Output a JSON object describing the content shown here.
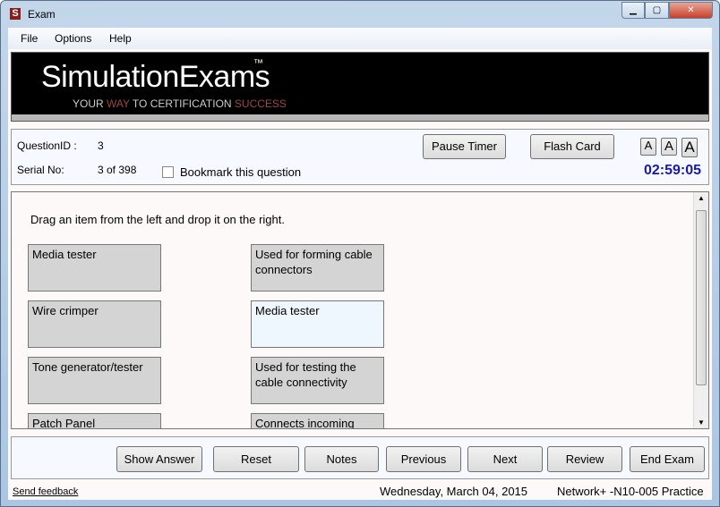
{
  "window": {
    "title": "Exam",
    "app_icon": "S",
    "controls": [
      "minimize",
      "maximize",
      "close"
    ]
  },
  "menu": [
    "File",
    "Options",
    "Help"
  ],
  "banner": {
    "logo": "SimulationExams",
    "tm": "™",
    "tagline": [
      "YOUR ",
      "WAY",
      " TO CERTIFICATION ",
      "SUCCESS"
    ]
  },
  "info": {
    "question_id_label": "QuestionID :",
    "question_id": "3",
    "serial_label": "Serial No:",
    "serial": "3 of 398",
    "bookmark_label": "Bookmark this question",
    "bookmark_checked": false,
    "pause_timer": "Pause Timer",
    "flash_card": "Flash Card",
    "font_sizes": [
      "A",
      "A",
      "A"
    ],
    "timer": "02:59:05"
  },
  "question": {
    "instruction": "Drag an item from the left and drop it on the right.",
    "left_items": [
      "Media tester",
      "Wire crimper",
      "Tone generator/tester",
      "Patch Panel"
    ],
    "right_items": [
      "Used for forming cable connectors",
      "Media tester",
      "Used for testing the cable connectivity",
      "Connects incoming"
    ]
  },
  "buttons": [
    "Show Answer",
    "Reset",
    "Notes",
    "Previous",
    "Next",
    "Review",
    "End Exam"
  ],
  "status": {
    "feedback": "Send feedback",
    "date": "Wednesday, March 04, 2015",
    "exam": "Network+ -N10-005 Practice"
  },
  "colors": {
    "timer": "#1a1aa8",
    "tag_accent": "#a04444",
    "dropped_item": "#eef6fe"
  }
}
